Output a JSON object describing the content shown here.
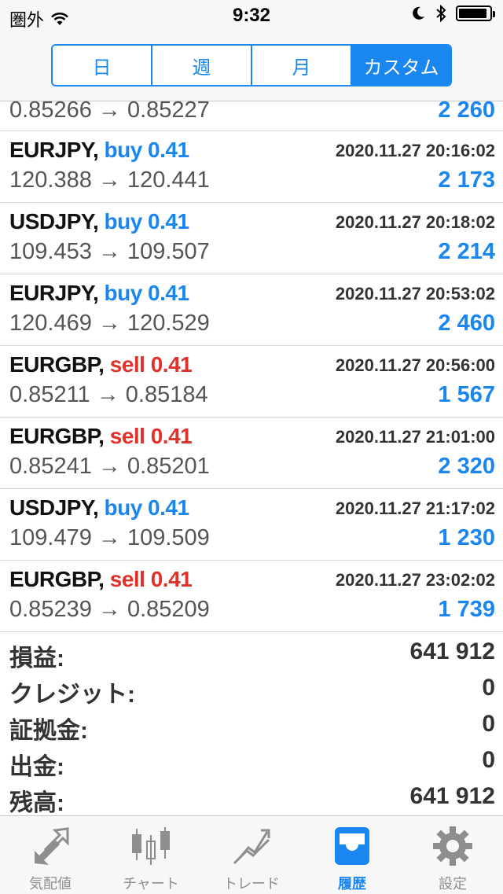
{
  "status_bar": {
    "carrier": "圏外",
    "time": "9:32",
    "battery_level_percent": 92
  },
  "segments": [
    {
      "label": "日",
      "active": false
    },
    {
      "label": "週",
      "active": false
    },
    {
      "label": "月",
      "active": false
    },
    {
      "label": "カスタム",
      "active": true
    }
  ],
  "partial_row": {
    "prices": "0.85266 → 0.85227",
    "profit": "2 260"
  },
  "deals": [
    {
      "symbol": "EURJPY,",
      "side": "buy 0.41",
      "type": "buy",
      "time": "2020.11.27 20:16:02",
      "prices": "120.388 → 120.441",
      "profit": "2 173"
    },
    {
      "symbol": "USDJPY,",
      "side": "buy 0.41",
      "type": "buy",
      "time": "2020.11.27 20:18:02",
      "prices": "109.453 → 109.507",
      "profit": "2 214"
    },
    {
      "symbol": "EURJPY,",
      "side": "buy 0.41",
      "type": "buy",
      "time": "2020.11.27 20:53:02",
      "prices": "120.469 → 120.529",
      "profit": "2 460"
    },
    {
      "symbol": "EURGBP,",
      "side": "sell 0.41",
      "type": "sell",
      "time": "2020.11.27 20:56:00",
      "prices": "0.85211 → 0.85184",
      "profit": "1 567"
    },
    {
      "symbol": "EURGBP,",
      "side": "sell 0.41",
      "type": "sell",
      "time": "2020.11.27 21:01:00",
      "prices": "0.85241 → 0.85201",
      "profit": "2 320"
    },
    {
      "symbol": "USDJPY,",
      "side": "buy 0.41",
      "type": "buy",
      "time": "2020.11.27 21:17:02",
      "prices": "109.479 → 109.509",
      "profit": "1 230"
    },
    {
      "symbol": "EURGBP,",
      "side": "sell 0.41",
      "type": "sell",
      "time": "2020.11.27 23:02:02",
      "prices": "0.85239 → 0.85209",
      "profit": "1 739"
    }
  ],
  "summary": [
    {
      "label": "損益:",
      "value": "641 912"
    },
    {
      "label": "クレジット:",
      "value": "0"
    },
    {
      "label": "証拠金:",
      "value": "0"
    },
    {
      "label": "出金:",
      "value": "0"
    },
    {
      "label": "残高:",
      "value": "641 912"
    }
  ],
  "tabs": [
    {
      "label": "気配値",
      "icon": "quotes-arrows-icon",
      "active": false
    },
    {
      "label": "チャート",
      "icon": "candlestick-chart-icon",
      "active": false
    },
    {
      "label": "トレード",
      "icon": "trade-trend-icon",
      "active": false
    },
    {
      "label": "履歴",
      "icon": "history-inbox-icon",
      "active": true
    },
    {
      "label": "設定",
      "icon": "settings-gear-icon",
      "active": false
    }
  ],
  "colors": {
    "accent": "#1a86f0",
    "sell": "#e0312b",
    "inactive_icon": "#8e8e8e"
  }
}
